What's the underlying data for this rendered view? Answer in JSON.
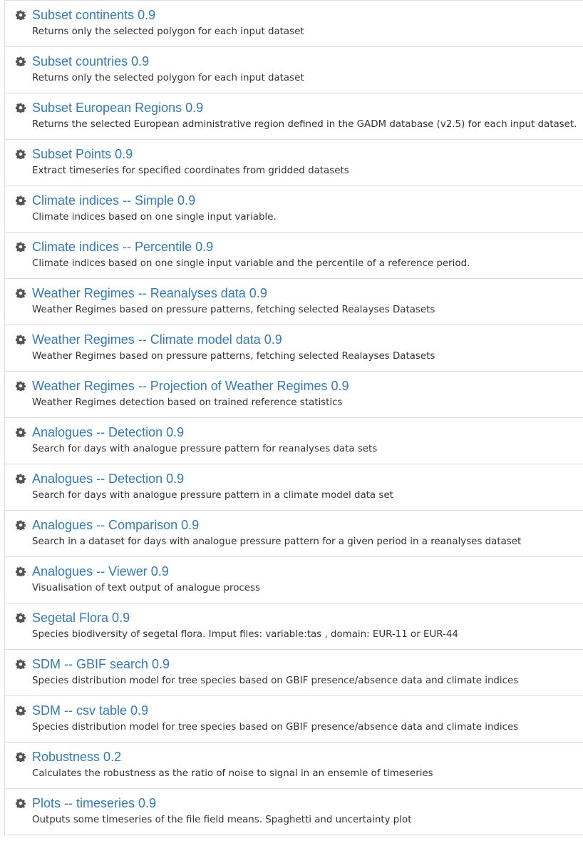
{
  "processes": [
    {
      "title": "Subset continents 0.9",
      "description": "Returns only the selected polygon for each input dataset",
      "icon": "gear-icon"
    },
    {
      "title": "Subset countries 0.9",
      "description": "Returns only the selected polygon for each input dataset",
      "icon": "gear-icon"
    },
    {
      "title": "Subset European Regions 0.9",
      "description": "Returns the selected European administrative region defined in the GADM database (v2.5) for each input dataset.",
      "icon": "gear-icon"
    },
    {
      "title": "Subset Points 0.9",
      "description": "Extract timeseries for specified coordinates from gridded datasets",
      "icon": "gear-icon"
    },
    {
      "title": "Climate indices -- Simple 0.9",
      "description": "Climate indices based on one single input variable.",
      "icon": "gear-icon"
    },
    {
      "title": "Climate indices -- Percentile 0.9",
      "description": "Climate indices based on one single input variable and the percentile of a reference period.",
      "icon": "gear-icon"
    },
    {
      "title": "Weather Regimes -- Reanalyses data 0.9",
      "description": "Weather Regimes based on pressure patterns, fetching selected Realayses Datasets",
      "icon": "gear-icon"
    },
    {
      "title": "Weather Regimes -- Climate model data 0.9",
      "description": "Weather Regimes based on pressure patterns, fetching selected Realayses Datasets",
      "icon": "gear-icon"
    },
    {
      "title": "Weather Regimes -- Projection of Weather Regimes 0.9",
      "description": "Weather Regimes detection based on trained reference statistics",
      "icon": "gear-icon"
    },
    {
      "title": "Analogues -- Detection 0.9",
      "description": "Search for days with analogue pressure pattern for reanalyses data sets",
      "icon": "gear-icon"
    },
    {
      "title": "Analogues -- Detection 0.9",
      "description": "Search for days with analogue pressure pattern in a climate model data set",
      "icon": "gear-icon"
    },
    {
      "title": "Analogues -- Comparison 0.9",
      "description": "Search in a dataset for days with analogue pressure pattern for a given period in a reanalyses dataset",
      "icon": "gear-icon"
    },
    {
      "title": "Analogues -- Viewer 0.9",
      "description": "Visualisation of text output of analogue process",
      "icon": "gear-icon"
    },
    {
      "title": "Segetal Flora 0.9",
      "description": "Species biodiversity of segetal flora. Imput files: variable:tas , domain: EUR-11 or EUR-44",
      "icon": "gear-icon"
    },
    {
      "title": "SDM -- GBIF search 0.9",
      "description": "Species distribution model for tree species based on GBIF presence/absence data and climate indices",
      "icon": "gear-icon"
    },
    {
      "title": "SDM -- csv table 0.9",
      "description": "Species distribution model for tree species based on GBIF presence/absence data and climate indices",
      "icon": "gear-icon"
    },
    {
      "title": "Robustness 0.2",
      "description": "Calculates the robustness as the ratio of noise to signal in an ensemle of timeseries",
      "icon": "gear-icon"
    },
    {
      "title": "Plots -- timeseries 0.9",
      "description": "Outputs some timeseries of the file field means. Spaghetti and uncertainty plot",
      "icon": "gear-icon"
    }
  ]
}
